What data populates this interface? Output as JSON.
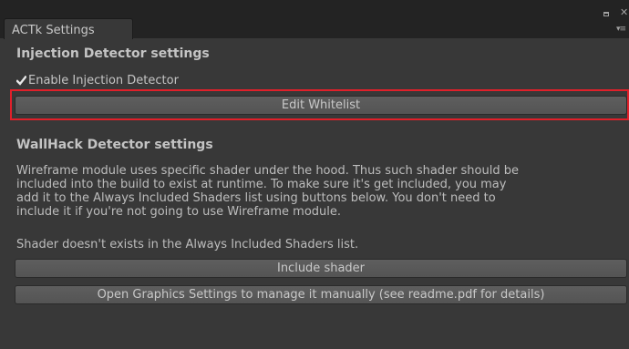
{
  "window": {
    "tab_title": "ACTk Settings",
    "controls": {
      "maximize_icon": "maximize-icon",
      "close_glyph": "✕",
      "menu_glyph": "▾≡"
    }
  },
  "injection": {
    "title": "Injection Detector settings",
    "enable_label": "Enable Injection Detector",
    "enable_checked": true,
    "edit_whitelist_label": "Edit Whitelist",
    "highlight_color": "#e0202a"
  },
  "wallhack": {
    "title": "WallHack Detector settings",
    "description_lines": [
      "Wireframe module uses specific shader under the hood. Thus such shader should be",
      "included into the build to exist at runtime. To make sure it's get included, you may",
      "add it to the Always Included Shaders list using buttons below. You don't need to",
      "include it if you're not going to use Wireframe module."
    ],
    "status_text": "Shader doesn't exists in the Always Included Shaders list.",
    "include_shader_label": "Include shader",
    "open_graphics_label": "Open Graphics Settings to manage it manually (see readme.pdf for details)"
  }
}
